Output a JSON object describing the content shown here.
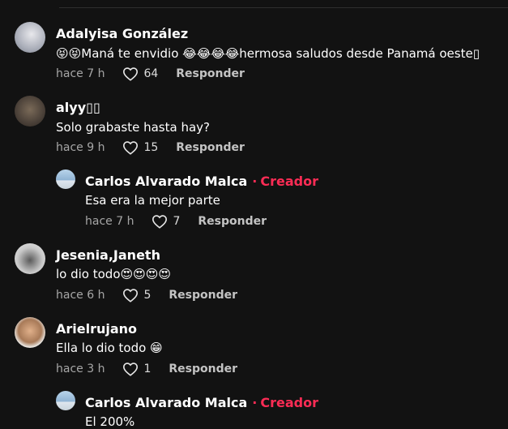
{
  "comments": [
    {
      "user": "Adalyisa González",
      "text": "😝😝Maná te envidio 😂😂😂😂hermosa saludos desde Panamá oeste▯",
      "time": "hace 7 h",
      "likes": "64",
      "reply_label": "Responder"
    },
    {
      "user": "alyy▯▯",
      "text": "Solo grabaste hasta hay?",
      "time": "hace 9 h",
      "likes": "15",
      "reply_label": "Responder",
      "reply": {
        "user": "Carlos Alvarado Malca",
        "badge": "Creador",
        "text": "Esa era la mejor parte",
        "time": "hace 7 h",
        "likes": "7",
        "reply_label": "Responder"
      }
    },
    {
      "user": "Jesenia,Janeth",
      "text": "lo dio todo😍😍😍😍",
      "time": "hace 6 h",
      "likes": "5",
      "reply_label": "Responder"
    },
    {
      "user": "Arielrujano",
      "text": "Ella lo dio todo 😁",
      "time": "hace 3 h",
      "likes": "1",
      "reply_label": "Responder",
      "reply": {
        "user": "Carlos Alvarado Malca",
        "badge": "Creador",
        "text": "El 200%"
      }
    }
  ],
  "colors": {
    "background": "#121212",
    "creator_accent": "#fe2c55"
  }
}
